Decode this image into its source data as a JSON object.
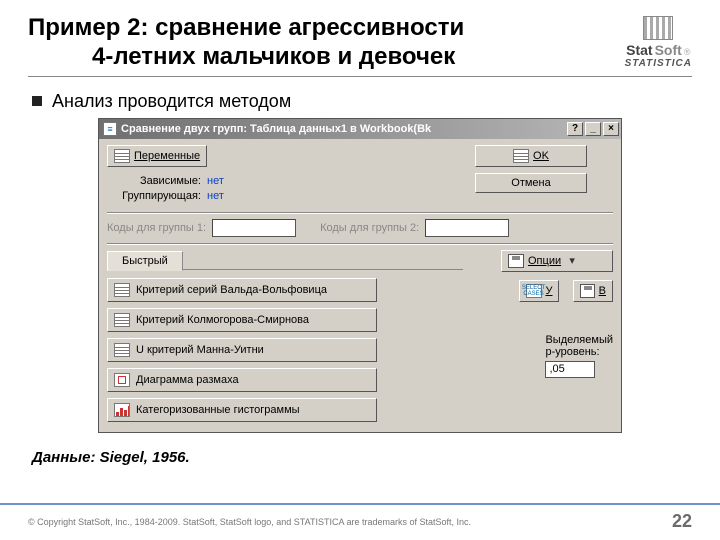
{
  "header": {
    "title_line1": "Пример 2: сравнение агрессивности",
    "title_line2": "4-летних мальчиков и девочек"
  },
  "logo": {
    "brand1": "Stat",
    "brand2": "Soft",
    "tm": "®",
    "subtitle": "STATISTICA"
  },
  "bullet": "Анализ проводится методом",
  "dialog": {
    "title": "Сравнение двух групп: Таблица данных1 в Workbook(Bk",
    "help": "?",
    "min": "_",
    "close": "×",
    "variables_btn": "Переменные",
    "ok_btn": "OK",
    "cancel_btn": "Отмена",
    "dependent_lbl": "Зависимые:",
    "dependent_val": "нет",
    "grouping_lbl": "Группирующая:",
    "grouping_val": "нет",
    "code1_lbl": "Коды для группы 1:",
    "code2_lbl": "Коды для группы 2:",
    "tab_quick": "Быстрый",
    "options_btn": "Опции",
    "select_cases_btn": "У",
    "weighted_btn": "В",
    "select_cases_icon": "SELECT CASES",
    "methods": {
      "wald": "Критерий серий Вальда-Вольфовица",
      "ks": "Критерий Колмогорова-Смирнова",
      "mw": "U критерий Манна-Уитни",
      "box": "Диаграмма размаха",
      "hist": "Категоризованные гистограммы"
    },
    "plevel_lbl1": "Выделяемый",
    "plevel_lbl2": "р-уровень:",
    "plevel_val": ",05"
  },
  "data_source": "Данные: Siegel, 1956.",
  "footer": {
    "copyright": "© Copyright StatSoft, Inc., 1984-2009. StatSoft, StatSoft logo, and STATISTICA are trademarks of StatSoft, Inc.",
    "page": "22"
  }
}
